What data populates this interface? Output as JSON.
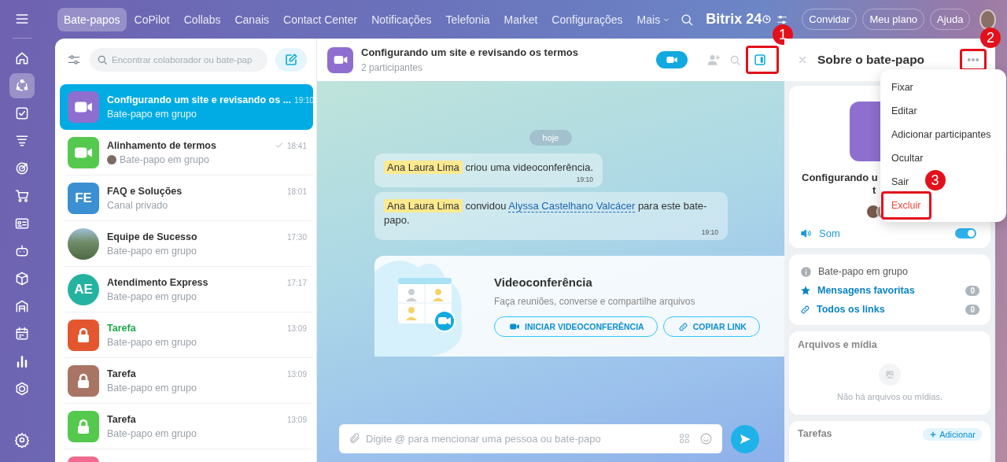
{
  "rail": {
    "items": [
      {
        "selected": false
      },
      {
        "selected": true
      },
      {
        "selected": false
      },
      {
        "selected": false
      },
      {
        "selected": false
      },
      {
        "selected": false
      },
      {
        "selected": false
      },
      {
        "selected": false
      },
      {
        "selected": false
      },
      {
        "selected": false
      },
      {
        "selected": false
      },
      {
        "selected": false
      },
      {
        "selected": false
      },
      {
        "selected": false
      }
    ]
  },
  "top_nav": {
    "tabs": [
      {
        "label": "Bate-papos",
        "selected": true,
        "dropdown": false
      },
      {
        "label": "CoPilot",
        "selected": false,
        "dropdown": false
      },
      {
        "label": "Collabs",
        "selected": false,
        "dropdown": false
      },
      {
        "label": "Canais",
        "selected": false,
        "dropdown": false
      },
      {
        "label": "Contact Center",
        "selected": false,
        "dropdown": false
      },
      {
        "label": "Notificações",
        "selected": false,
        "dropdown": false
      },
      {
        "label": "Telefonia",
        "selected": false,
        "dropdown": false
      },
      {
        "label": "Market",
        "selected": false,
        "dropdown": false
      },
      {
        "label": "Configurações",
        "selected": false,
        "dropdown": false
      },
      {
        "label": "Mais",
        "selected": false,
        "dropdown": true
      }
    ],
    "brand": "Bitrix 24",
    "buttons": [
      "Convidar",
      "Meu plano",
      "Ajuda"
    ]
  },
  "chat_list": {
    "search": {
      "placeholder": "Encontrar colaborador ou bate-pap"
    },
    "items": [
      {
        "name": "Configurando um site e revisando os ...",
        "subtitle": "Bate-papo em grupo",
        "time": "19:10",
        "avatar": {
          "kind": "video",
          "color": "#8e6fd0",
          "round": false
        },
        "selected": true,
        "highlighted": false,
        "checkmark": false,
        "sender_avatar": false
      },
      {
        "name": "Alinhamento de termos",
        "subtitle": "Bate-papo em grupo",
        "time": "18:41",
        "avatar": {
          "kind": "video",
          "color": "#55c94e",
          "round": false
        },
        "selected": false,
        "highlighted": false,
        "checkmark": true,
        "sender_avatar": true
      },
      {
        "name": "FAQ e Soluções",
        "subtitle": "Canal privado",
        "time": "18:01",
        "avatar": {
          "kind": "initials",
          "text": "FE",
          "color": "#3b8fd3",
          "round": false
        },
        "selected": false,
        "highlighted": false,
        "checkmark": false,
        "sender_avatar": false
      },
      {
        "name": "Equipe de Sucesso",
        "subtitle": "Bate-papo em grupo",
        "time": "17:30",
        "avatar": {
          "kind": "photo",
          "color": "#6f8c66",
          "round": true
        },
        "selected": false,
        "highlighted": false,
        "checkmark": false,
        "sender_avatar": false
      },
      {
        "name": "Atendimento Express",
        "subtitle": "Bate-papo em grupo",
        "time": "17:17",
        "avatar": {
          "kind": "initials",
          "text": "AE",
          "color": "#24b3a0",
          "round": true
        },
        "selected": false,
        "highlighted": false,
        "checkmark": false,
        "sender_avatar": false
      },
      {
        "name": "Tarefa",
        "subtitle": "Bate-papo em grupo",
        "time": "13:09",
        "avatar": {
          "kind": "lock",
          "color": "#e4572e",
          "round": false
        },
        "selected": false,
        "highlighted": true,
        "checkmark": false,
        "sender_avatar": false
      },
      {
        "name": "Tarefa",
        "subtitle": "Bate-papo em grupo",
        "time": "13:09",
        "avatar": {
          "kind": "lock",
          "color": "#a87565",
          "round": false
        },
        "selected": false,
        "highlighted": false,
        "checkmark": false,
        "sender_avatar": false
      },
      {
        "name": "Tarefa",
        "subtitle": "Bate-papo em grupo",
        "time": "13:09",
        "avatar": {
          "kind": "lock",
          "color": "#55c94e",
          "round": false
        },
        "selected": false,
        "highlighted": false,
        "checkmark": false,
        "sender_avatar": false
      },
      {
        "avatar": {
          "kind": "lock",
          "color": "#f06a8f",
          "round": false
        },
        "selected": false
      }
    ]
  },
  "chat": {
    "title": "Configurando um site e revisando os termos",
    "subtitle": "2 participantes",
    "panel_annotation": "1",
    "date_separator": "hoje",
    "messages": [
      {
        "parts": [
          {
            "kind": "mention",
            "text": "Ana Laura Lima"
          },
          {
            "kind": "text",
            "text": "criou uma videoconferência."
          }
        ],
        "time": "19:10"
      },
      {
        "parts": [
          {
            "kind": "mention",
            "text": "Ana Laura Lima"
          },
          {
            "kind": "text",
            "text": "convidou"
          },
          {
            "kind": "link",
            "text": "Alyssa Castelhano Valcácer"
          },
          {
            "kind": "text",
            "text": "para este bate-papo."
          }
        ],
        "time": "19:10"
      }
    ],
    "video_card": {
      "title": "Videoconferência",
      "subtitle": "Faça reuniões, converse e compartilhe arquivos",
      "buttons": [
        {
          "label": "INICIAR VIDEOCONFERÊNCIA",
          "kind": "video"
        },
        {
          "label": "COPIAR LINK",
          "kind": "link"
        }
      ]
    },
    "input": {
      "placeholder": "Digite @ para mencionar uma pessoa ou bate-papo"
    }
  },
  "info": {
    "title": "Sobre o bate-papo",
    "more_annotation": "2",
    "name_lines": [
      "Configurando u",
      "t"
    ],
    "sound": {
      "label": "Som",
      "on": true
    },
    "type_label": "Bate-papo em grupo",
    "links": [
      {
        "label": "Mensagens favoritas",
        "count": "0",
        "kind": "star"
      },
      {
        "label": "Todos os links",
        "count": "0",
        "kind": "link"
      }
    ],
    "files": {
      "title": "Arquivos e mídia",
      "empty": "Não há arquivos ou mídias."
    },
    "tasks": {
      "title": "Tarefas",
      "add": "Adicionar"
    },
    "menu": {
      "items": [
        {
          "label": "Fixar",
          "kind": "normal"
        },
        {
          "label": "Editar",
          "kind": "normal"
        },
        {
          "label": "Adicionar participantes",
          "kind": "normal"
        },
        {
          "label": "Ocultar",
          "kind": "normal"
        },
        {
          "label": "Sair",
          "kind": "normal"
        },
        {
          "label": "Excluir",
          "kind": "danger",
          "annotation": "3"
        }
      ]
    }
  }
}
